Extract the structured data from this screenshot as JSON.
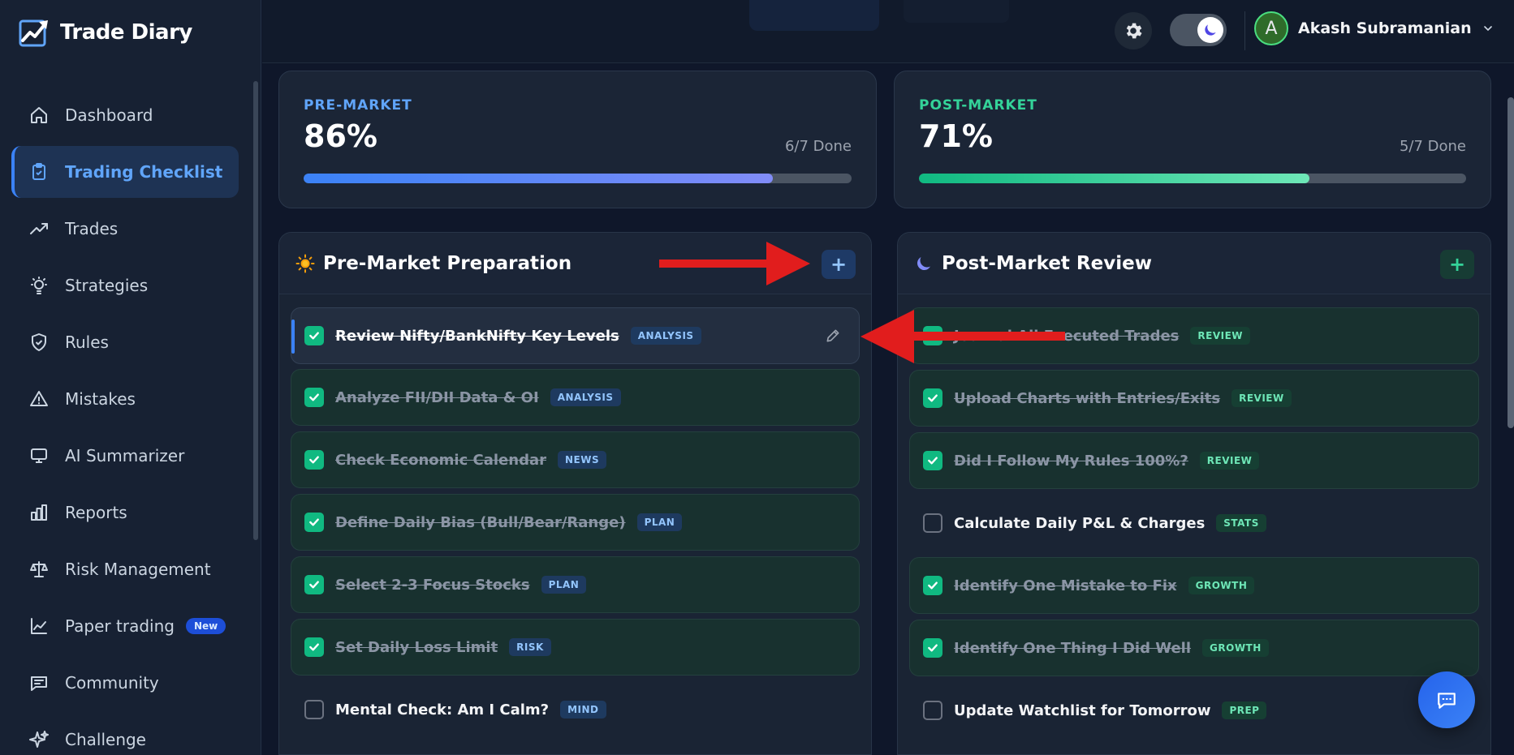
{
  "brand": {
    "name": "Trade Diary",
    "icon": "chart-up-logo-icon"
  },
  "sidebar": {
    "items": [
      {
        "label": "Dashboard",
        "icon": "home-icon",
        "active": false
      },
      {
        "label": "Trading Checklist",
        "icon": "clipboard-check-icon",
        "active": true
      },
      {
        "label": "Trades",
        "icon": "trend-up-icon",
        "active": false
      },
      {
        "label": "Strategies",
        "icon": "lightbulb-icon",
        "active": false
      },
      {
        "label": "Rules",
        "icon": "shield-check-icon",
        "active": false
      },
      {
        "label": "Mistakes",
        "icon": "warning-triangle-icon",
        "active": false
      },
      {
        "label": "AI Summarizer",
        "icon": "monitor-icon",
        "active": false
      },
      {
        "label": "Reports",
        "icon": "bar-chart-icon",
        "active": false
      },
      {
        "label": "Risk Management",
        "icon": "scale-icon",
        "active": false
      },
      {
        "label": "Paper trading",
        "icon": "line-chart-icon",
        "active": false,
        "badge": "New"
      },
      {
        "label": "Community",
        "icon": "message-square-icon",
        "active": false
      },
      {
        "label": "Challenge",
        "icon": "sparkle-icon",
        "active": false
      }
    ]
  },
  "header": {
    "user_initial": "A",
    "user_name": "Akash Subramanian",
    "theme": "dark"
  },
  "progress": {
    "pre": {
      "label": "PRE-MARKET",
      "percent_text": "86%",
      "done_text": "6/7 Done",
      "fraction": 0.857,
      "color": "#60a5fa"
    },
    "post": {
      "label": "POST-MARKET",
      "percent_text": "71%",
      "done_text": "5/7 Done",
      "fraction": 0.714,
      "color": "#34d399"
    }
  },
  "pre_market": {
    "title": "Pre-Market Preparation",
    "icon": "sun-icon",
    "add_label": "+",
    "items": [
      {
        "text": "Review Nifty/BankNifty Key Levels",
        "tag": "ANALYSIS",
        "checked": true,
        "highlight": true
      },
      {
        "text": "Analyze FII/DII Data & OI",
        "tag": "ANALYSIS",
        "checked": true
      },
      {
        "text": "Check Economic Calendar",
        "tag": "NEWS",
        "checked": true
      },
      {
        "text": "Define Daily Bias (Bull/Bear/Range)",
        "tag": "PLAN",
        "checked": true
      },
      {
        "text": "Select 2-3 Focus Stocks",
        "tag": "PLAN",
        "checked": true
      },
      {
        "text": "Set Daily Loss Limit",
        "tag": "RISK",
        "checked": true
      },
      {
        "text": "Mental Check: Am I Calm?",
        "tag": "MIND",
        "checked": false
      }
    ]
  },
  "post_market": {
    "title": "Post-Market Review",
    "icon": "moon-icon",
    "add_label": "+",
    "items": [
      {
        "text": "Journal All Executed Trades",
        "tag": "REVIEW",
        "checked": true
      },
      {
        "text": "Upload Charts with Entries/Exits",
        "tag": "REVIEW",
        "checked": true
      },
      {
        "text": "Did I Follow My Rules 100%?",
        "tag": "REVIEW",
        "checked": true
      },
      {
        "text": "Calculate Daily P&L & Charges",
        "tag": "STATS",
        "checked": false
      },
      {
        "text": "Identify One Mistake to Fix",
        "tag": "GROWTH",
        "checked": true
      },
      {
        "text": "Identify One Thing I Did Well",
        "tag": "GROWTH",
        "checked": true
      },
      {
        "text": "Update Watchlist for Tomorrow",
        "tag": "PREP",
        "checked": false
      }
    ]
  },
  "colors": {
    "accent_blue": "#3b82f6",
    "accent_green": "#10b981",
    "annotation_arrow": "#e11d1d"
  }
}
